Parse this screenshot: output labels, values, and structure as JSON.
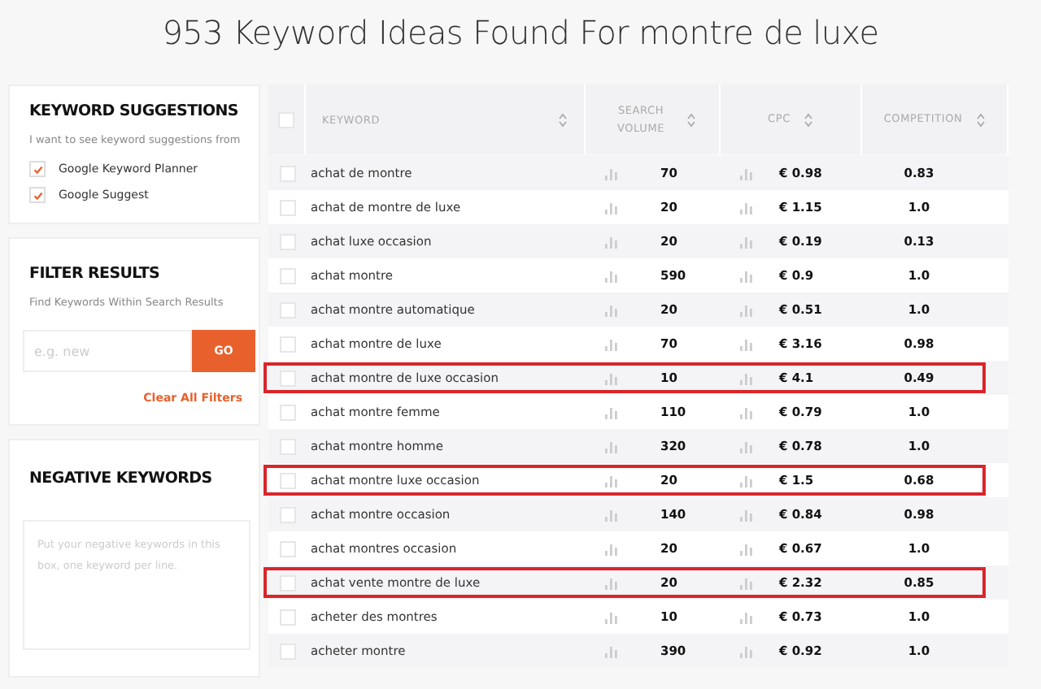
{
  "title": "953 Keyword Ideas Found For montre de luxe",
  "keyword_suggestions": {
    "heading": "KEYWORD SUGGESTIONS",
    "description": "I want to see keyword suggestions from",
    "sources": [
      {
        "label": "Google Keyword Planner",
        "checked": true
      },
      {
        "label": "Google Suggest",
        "checked": true
      }
    ]
  },
  "filter_results": {
    "heading": "FILTER RESULTS",
    "description": "Find Keywords Within Search Results",
    "placeholder": "e.g. new",
    "button": "GO",
    "clear_link": "Clear All Filters"
  },
  "negative_keywords": {
    "heading": "NEGATIVE KEYWORDS",
    "placeholder": "Put your negative keywords in this box, one keyword per line."
  },
  "table": {
    "select_all": false,
    "columns": [
      "KEYWORD",
      "SEARCH VOLUME",
      "CPC",
      "COMPETITION"
    ],
    "rows": [
      {
        "keyword": "achat de montre",
        "volume": "70",
        "cpc": "€ 0.98",
        "competition": "0.83",
        "checked": false,
        "highlighted": false
      },
      {
        "keyword": "achat de montre de luxe",
        "volume": "20",
        "cpc": "€ 1.15",
        "competition": "1.0",
        "checked": false,
        "highlighted": false
      },
      {
        "keyword": "achat luxe occasion",
        "volume": "20",
        "cpc": "€ 0.19",
        "competition": "0.13",
        "checked": false,
        "highlighted": false
      },
      {
        "keyword": "achat montre",
        "volume": "590",
        "cpc": "€ 0.9",
        "competition": "1.0",
        "checked": false,
        "highlighted": false
      },
      {
        "keyword": "achat montre automatique",
        "volume": "20",
        "cpc": "€ 0.51",
        "competition": "1.0",
        "checked": false,
        "highlighted": false
      },
      {
        "keyword": "achat montre de luxe",
        "volume": "70",
        "cpc": "€ 3.16",
        "competition": "0.98",
        "checked": false,
        "highlighted": false
      },
      {
        "keyword": "achat montre de luxe occasion",
        "volume": "10",
        "cpc": "€ 4.1",
        "competition": "0.49",
        "checked": false,
        "highlighted": true
      },
      {
        "keyword": "achat montre femme",
        "volume": "110",
        "cpc": "€ 0.79",
        "competition": "1.0",
        "checked": false,
        "highlighted": false
      },
      {
        "keyword": "achat montre homme",
        "volume": "320",
        "cpc": "€ 0.78",
        "competition": "1.0",
        "checked": false,
        "highlighted": false
      },
      {
        "keyword": "achat montre luxe occasion",
        "volume": "20",
        "cpc": "€ 1.5",
        "competition": "0.68",
        "checked": false,
        "highlighted": true
      },
      {
        "keyword": "achat montre occasion",
        "volume": "140",
        "cpc": "€ 0.84",
        "competition": "0.98",
        "checked": false,
        "highlighted": false
      },
      {
        "keyword": "achat montres occasion",
        "volume": "20",
        "cpc": "€ 0.67",
        "competition": "1.0",
        "checked": false,
        "highlighted": false
      },
      {
        "keyword": "achat vente montre de luxe",
        "volume": "20",
        "cpc": "€ 2.32",
        "competition": "0.85",
        "checked": false,
        "highlighted": true
      },
      {
        "keyword": "acheter des montres",
        "volume": "10",
        "cpc": "€ 0.73",
        "competition": "1.0",
        "checked": false,
        "highlighted": false
      },
      {
        "keyword": "acheter montre",
        "volume": "390",
        "cpc": "€ 0.92",
        "competition": "1.0",
        "checked": false,
        "highlighted": false
      }
    ]
  }
}
